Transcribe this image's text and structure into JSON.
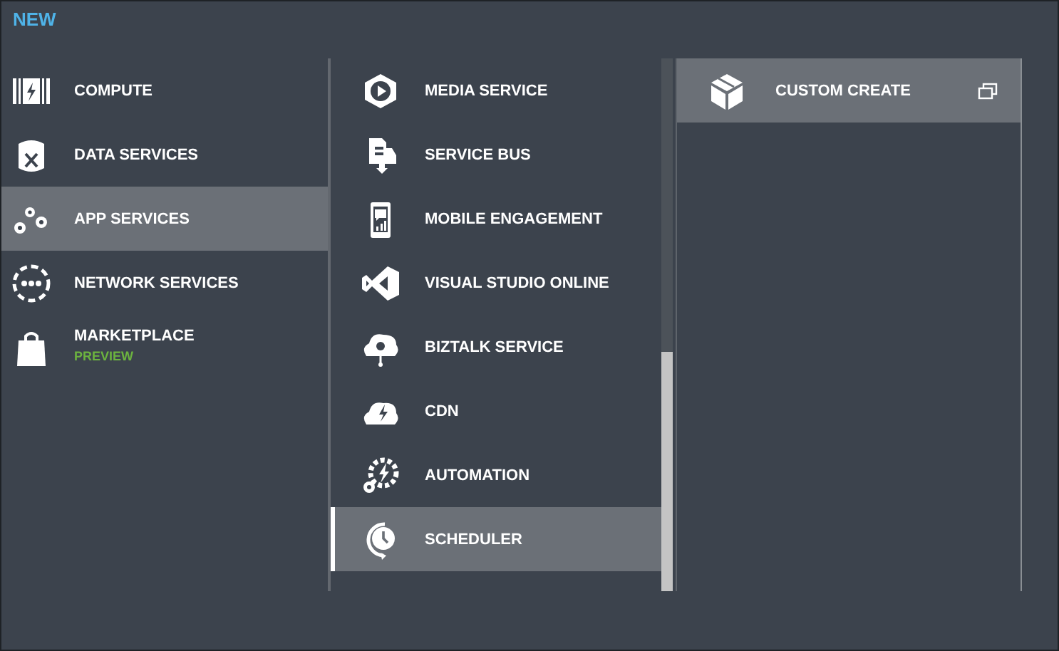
{
  "title": "NEW",
  "categories": [
    {
      "label": "COMPUTE",
      "selected": false
    },
    {
      "label": "DATA SERVICES",
      "selected": false
    },
    {
      "label": "APP SERVICES",
      "selected": true
    },
    {
      "label": "NETWORK SERVICES",
      "selected": false
    },
    {
      "label": "MARKETPLACE",
      "badge": "PREVIEW",
      "selected": false
    }
  ],
  "services": [
    {
      "label": "MEDIA SERVICE",
      "selected": false
    },
    {
      "label": "SERVICE BUS",
      "selected": false
    },
    {
      "label": "MOBILE ENGAGEMENT",
      "selected": false
    },
    {
      "label": "VISUAL STUDIO ONLINE",
      "selected": false
    },
    {
      "label": "BIZTALK SERVICE",
      "selected": false
    },
    {
      "label": "CDN",
      "selected": false
    },
    {
      "label": "AUTOMATION",
      "selected": false
    },
    {
      "label": "SCHEDULER",
      "selected": true
    }
  ],
  "options": [
    {
      "label": "CUSTOM CREATE",
      "selected": true
    }
  ]
}
